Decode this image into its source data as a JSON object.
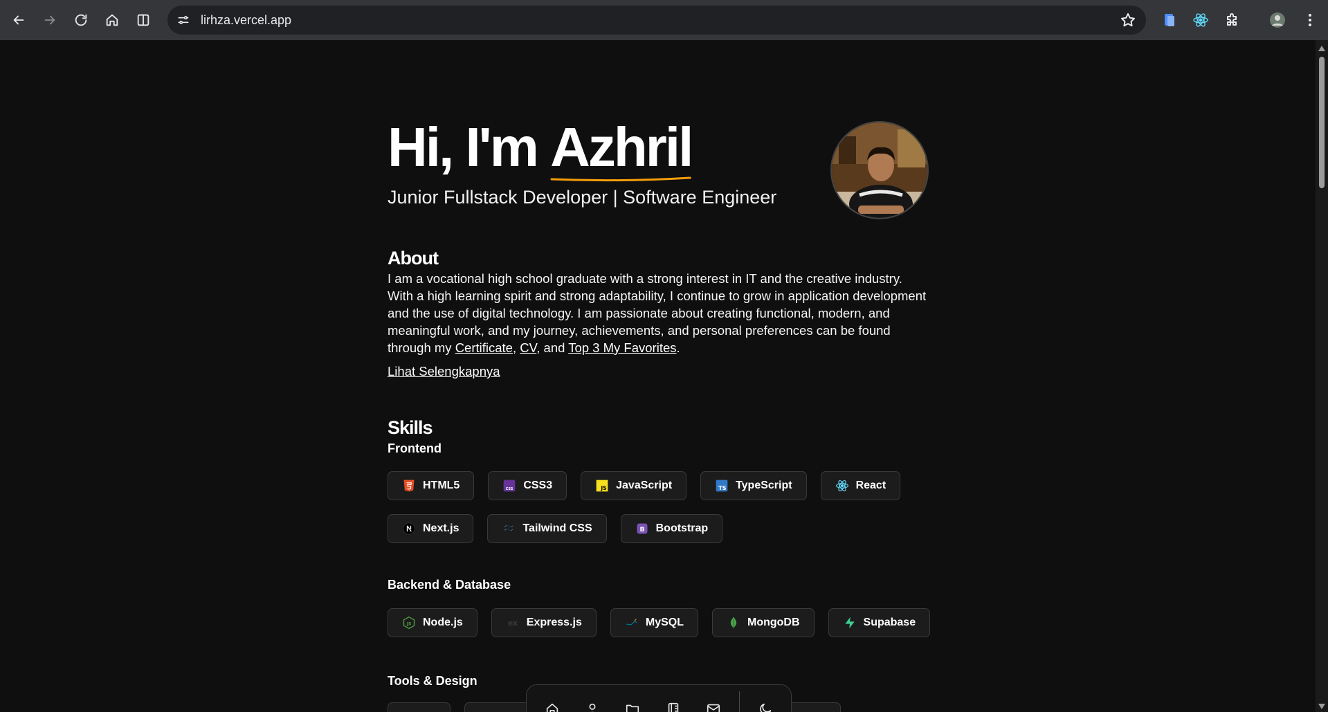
{
  "browser": {
    "url": "lirhza.vercel.app"
  },
  "hero": {
    "greeting": "Hi, I'm ",
    "name": "Azhril",
    "subtitle": "Junior Fullstack Developer | Software Engineer",
    "underline_color": "#f59e0b"
  },
  "about": {
    "title": "About",
    "text_part1": "I am a vocational high school graduate with a strong interest in IT and the creative industry. With a high learning spirit and strong adaptability, I continue to grow in application development and the use of digital technology. I am passionate about creating functional, modern, and meaningful work, and my journey, achievements, and personal preferences can be found through my ",
    "link_certificate": "Certificate",
    "sep1": ", ",
    "link_cv": "CV",
    "sep2": ", and ",
    "link_favorites": "Top 3 My Favorites",
    "end": ".",
    "see_more": "Lihat Selengkapnya"
  },
  "skills": {
    "title": "Skills",
    "frontend_title": "Frontend",
    "frontend_row1": [
      "HTML5",
      "CSS3",
      "JavaScript",
      "TypeScript",
      "React"
    ],
    "frontend_row2": [
      "Next.js",
      "Tailwind CSS",
      "Bootstrap"
    ],
    "backend_title": "Backend & Database",
    "backend": [
      "Node.js",
      "Express.js",
      "MySQL",
      "MongoDB",
      "Supabase"
    ],
    "tools_title": "Tools & Design"
  },
  "dock": {
    "items": [
      "home-icon",
      "user-icon",
      "folder-icon",
      "book-icon",
      "mail-icon",
      "moon-icon"
    ]
  },
  "colors": {
    "background": "#0f0f0f",
    "chip_bg": "#1c1c1c",
    "chip_border": "#3a3a3a"
  }
}
